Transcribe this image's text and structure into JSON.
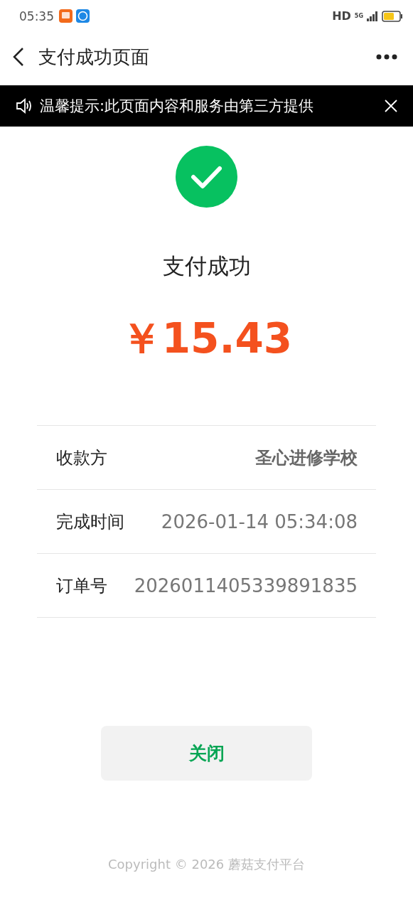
{
  "status_bar": {
    "time": "05:35",
    "network": "HD",
    "cellular": "5G"
  },
  "nav": {
    "title": "支付成功页面"
  },
  "notice": {
    "text": "温馨提示:此页面内容和服务由第三方提供"
  },
  "result": {
    "title": "支付成功",
    "amount": "￥15.43"
  },
  "details": [
    {
      "label": "收款方",
      "value": "圣心进修学校",
      "kind": "bold"
    },
    {
      "label": "完成时间",
      "value": "2026-01-14 05:34:08",
      "kind": "plain"
    },
    {
      "label": "订单号",
      "value": "2026011405339891835",
      "kind": "plain"
    }
  ],
  "close_button": "关闭",
  "footer": "Copyright © 2026 蘑菇支付平台"
}
